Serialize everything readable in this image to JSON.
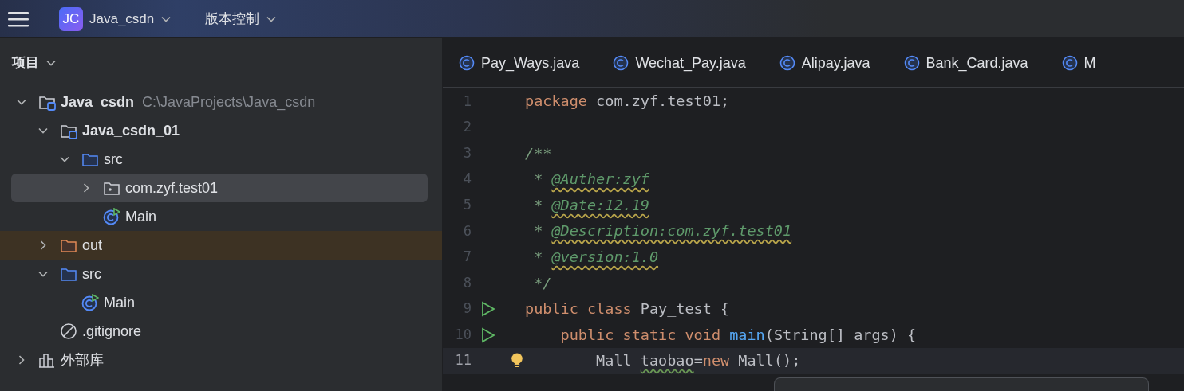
{
  "toolbar": {
    "project_badge": "JC",
    "project_name": "Java_csdn",
    "vcs_menu": "版本控制"
  },
  "sidebar": {
    "title": "项目",
    "tree": [
      {
        "label": "Java_csdn",
        "kind": "module",
        "hint": "C:\\JavaProjects\\Java_csdn",
        "expanded": true,
        "selected": false,
        "children": [
          {
            "label": "Java_csdn_01",
            "kind": "module",
            "expanded": true,
            "selected": false,
            "children": [
              {
                "label": "src",
                "kind": "folder",
                "expanded": true,
                "selected": false,
                "children": [
                  {
                    "label": "com.zyf.test01",
                    "kind": "package",
                    "expanded": false,
                    "selected": true
                  },
                  {
                    "label": "Main",
                    "kind": "class",
                    "selected": false
                  }
                ]
              }
            ]
          },
          {
            "label": "out",
            "kind": "excluded",
            "expanded": false,
            "selected": false
          },
          {
            "label": "src",
            "kind": "folder",
            "expanded": true,
            "selected": false,
            "children": [
              {
                "label": "Main",
                "kind": "class",
                "selected": false
              }
            ]
          },
          {
            "label": ".gitignore",
            "kind": "ignore",
            "selected": false
          }
        ]
      },
      {
        "label": "外部库",
        "kind": "library",
        "expanded": false,
        "selected": false
      }
    ]
  },
  "tabs": [
    {
      "label": "Pay_Ways.java",
      "selected": false
    },
    {
      "label": "Wechat_Pay.java",
      "selected": false
    },
    {
      "label": "Alipay.java",
      "selected": false
    },
    {
      "label": "Bank_Card.java",
      "selected": false
    },
    {
      "label": "M",
      "selected": false
    }
  ],
  "editor": {
    "lines": [
      {
        "number": "1",
        "tokens": [
          {
            "text": "package",
            "kind": "kw"
          },
          {
            "text": " com.zyf.test01;",
            "kind": "plain"
          }
        ]
      },
      {
        "number": "2"
      },
      {
        "number": "3",
        "tokens": [
          {
            "text": "/**",
            "kind": "comment"
          }
        ]
      },
      {
        "number": "4",
        "tokens": [
          {
            "text": " * ",
            "kind": "comment"
          },
          {
            "text": "@Auther:zyf",
            "kind": "doctag"
          }
        ]
      },
      {
        "number": "5",
        "tokens": [
          {
            "text": " * ",
            "kind": "comment"
          },
          {
            "text": "@Date:12.19",
            "kind": "doctag"
          }
        ]
      },
      {
        "number": "6",
        "tokens": [
          {
            "text": " * ",
            "kind": "comment"
          },
          {
            "text": "@Description:com.zyf.test01",
            "kind": "doctag"
          }
        ]
      },
      {
        "number": "7",
        "tokens": [
          {
            "text": " * ",
            "kind": "comment"
          },
          {
            "text": "@version:1.0",
            "kind": "doctag"
          }
        ]
      },
      {
        "number": "8",
        "tokens": [
          {
            "text": " */",
            "kind": "comment"
          }
        ]
      },
      {
        "number": "9",
        "run": true,
        "tokens": [
          {
            "text": "public class",
            "kind": "kw"
          },
          {
            "text": " Pay_test {",
            "kind": "plain"
          }
        ]
      },
      {
        "number": "10",
        "run": true,
        "tokens": [
          {
            "text": "    public static void ",
            "kind": "kw"
          },
          {
            "text": "main",
            "kind": "fn"
          },
          {
            "text": "(String[] args) {",
            "kind": "plain"
          }
        ]
      },
      {
        "number": "11",
        "current": true,
        "hint": true,
        "tokens": [
          {
            "text": "        Mall ",
            "kind": "plain"
          },
          {
            "text": "taobao",
            "kind": "warn"
          },
          {
            "text": "=",
            "kind": "plain"
          },
          {
            "text": "new",
            "kind": "kw"
          },
          {
            "text": " Mall();",
            "kind": "plain"
          }
        ]
      }
    ]
  }
}
